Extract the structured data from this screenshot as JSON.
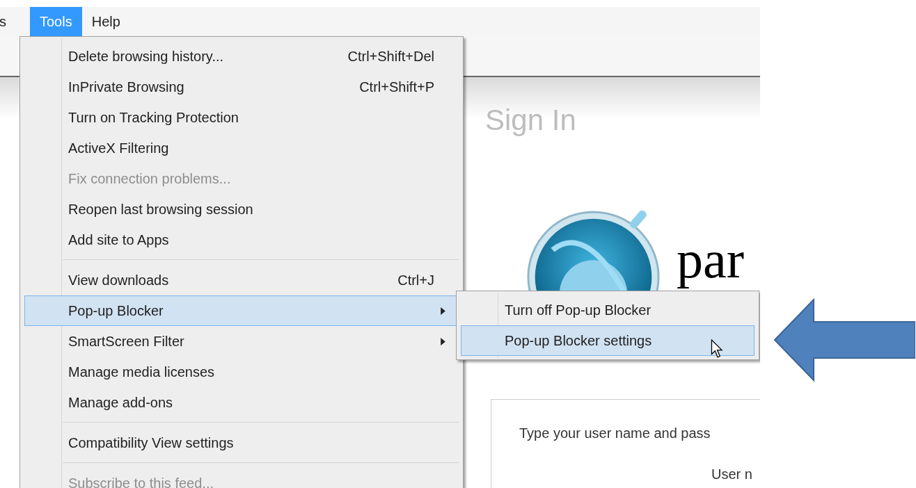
{
  "menu_bar": {
    "items": [
      {
        "label": "s",
        "selected": false
      },
      {
        "label": "Tools",
        "selected": true
      },
      {
        "label": "Help",
        "selected": false
      }
    ]
  },
  "tools_menu": {
    "items": [
      {
        "kind": "item",
        "label": "Delete browsing history...",
        "shortcut": "Ctrl+Shift+Del",
        "disabled": false,
        "selected": false,
        "submenu": false
      },
      {
        "kind": "item",
        "label": "InPrivate Browsing",
        "shortcut": "Ctrl+Shift+P",
        "disabled": false,
        "selected": false,
        "submenu": false
      },
      {
        "kind": "item",
        "label": "Turn on Tracking Protection",
        "disabled": false,
        "selected": false,
        "submenu": false
      },
      {
        "kind": "item",
        "label": "ActiveX Filtering",
        "disabled": false,
        "selected": false,
        "submenu": false
      },
      {
        "kind": "item",
        "label": "Fix connection problems...",
        "disabled": true,
        "selected": false,
        "submenu": false
      },
      {
        "kind": "item",
        "label": "Reopen last browsing session",
        "disabled": false,
        "selected": false,
        "submenu": false
      },
      {
        "kind": "item",
        "label": "Add site to Apps",
        "disabled": false,
        "selected": false,
        "submenu": false
      },
      {
        "kind": "separator"
      },
      {
        "kind": "item",
        "label": "View downloads",
        "shortcut": "Ctrl+J",
        "disabled": false,
        "selected": false,
        "submenu": false
      },
      {
        "kind": "item",
        "label": "Pop-up Blocker",
        "disabled": false,
        "selected": true,
        "submenu": true
      },
      {
        "kind": "item",
        "label": "SmartScreen Filter",
        "disabled": false,
        "selected": false,
        "submenu": true
      },
      {
        "kind": "item",
        "label": "Manage media licenses",
        "disabled": false,
        "selected": false,
        "submenu": false
      },
      {
        "kind": "item",
        "label": "Manage add-ons",
        "disabled": false,
        "selected": false,
        "submenu": false
      },
      {
        "kind": "separator"
      },
      {
        "kind": "item",
        "label": "Compatibility View settings",
        "disabled": false,
        "selected": false,
        "submenu": false
      },
      {
        "kind": "separator"
      },
      {
        "kind": "item",
        "label": "Subscribe to this feed...",
        "disabled": true,
        "selected": false,
        "submenu": false
      }
    ]
  },
  "submenu": {
    "items": [
      {
        "label": "Turn off Pop-up Blocker",
        "selected": false
      },
      {
        "label": "Pop-up Blocker settings",
        "selected": true
      }
    ]
  },
  "page": {
    "heading": "Sign In",
    "logo_text": "par",
    "login_prompt": "Type your user name and pass",
    "field_label": "User n"
  }
}
